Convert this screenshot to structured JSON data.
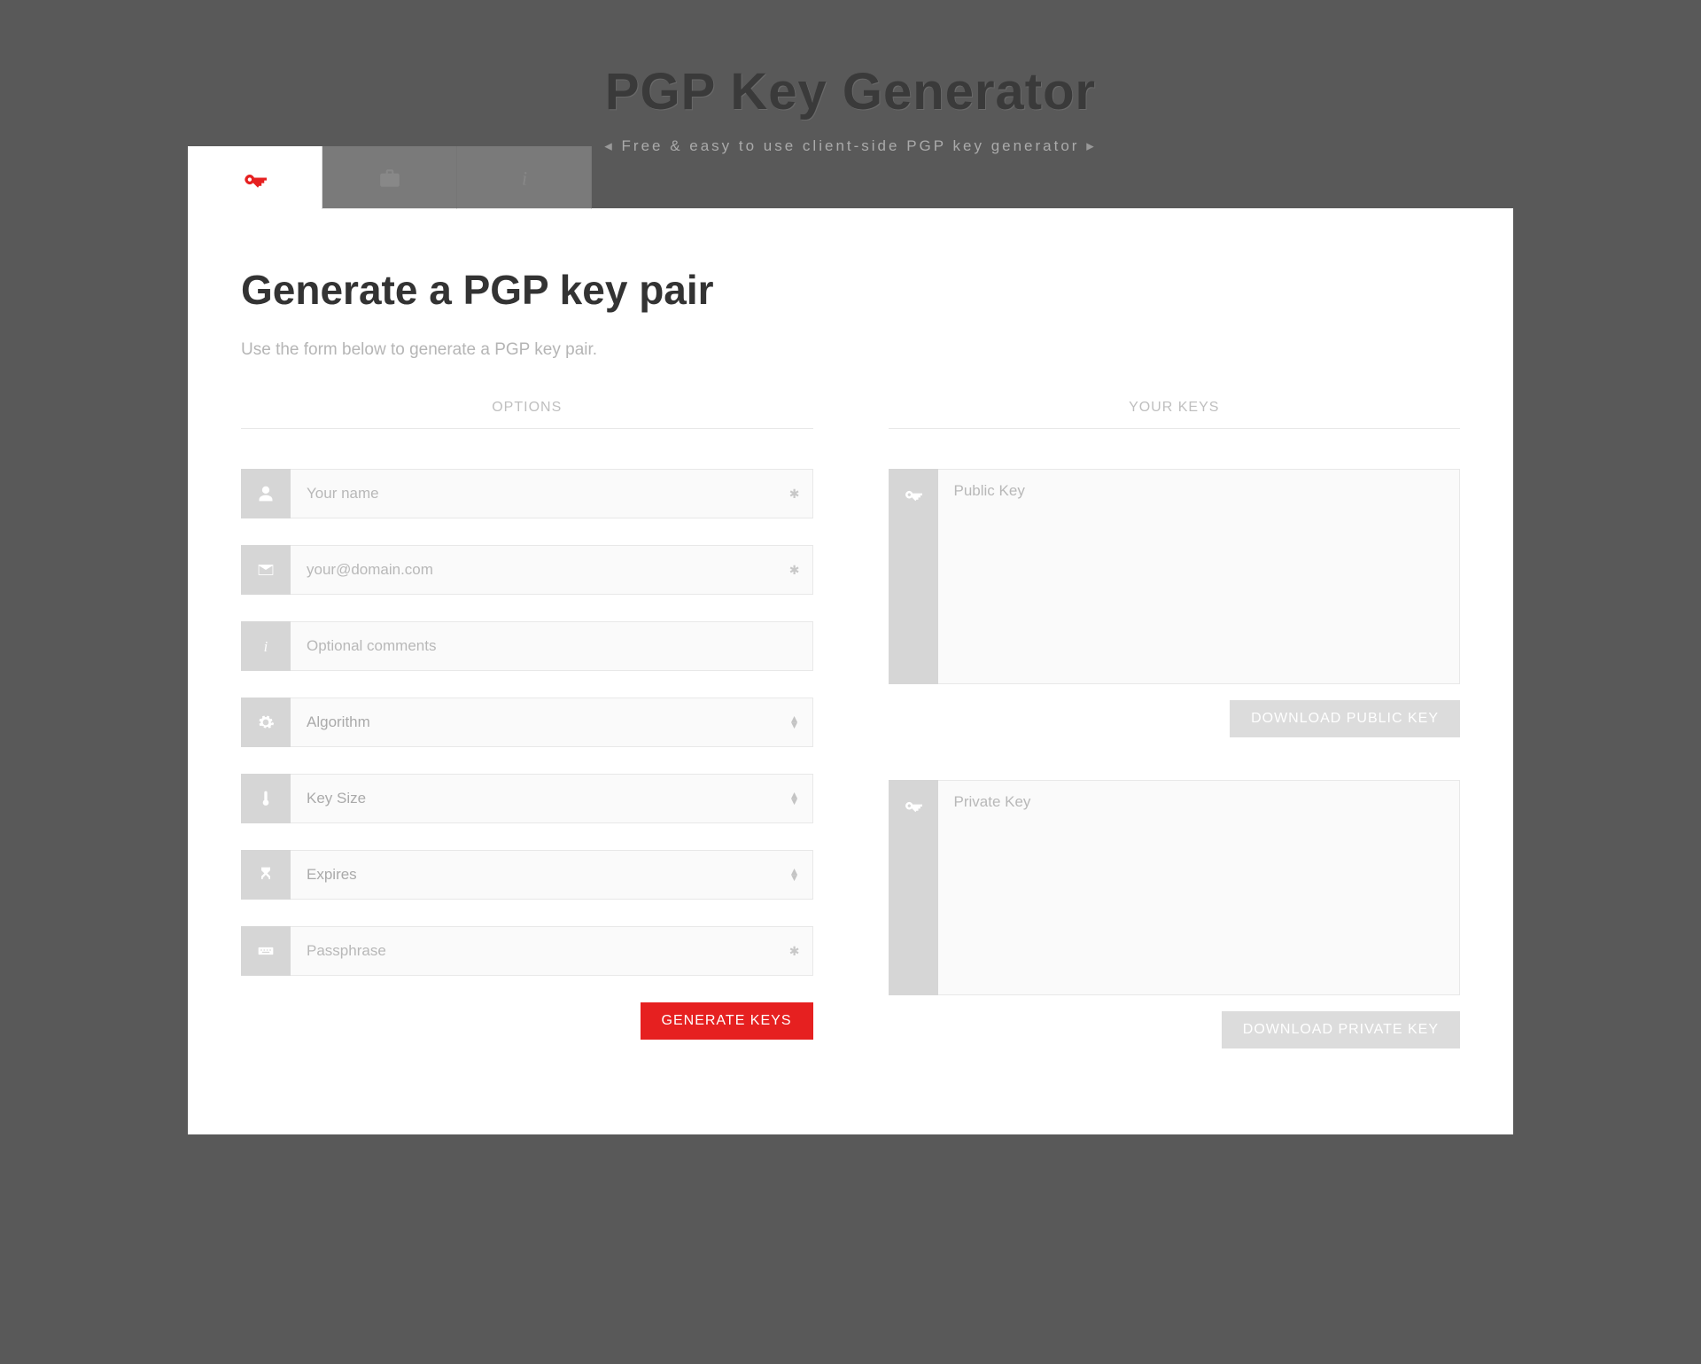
{
  "header": {
    "title": "PGP Key Generator",
    "subtitle": "Free & easy to use client-side PGP key generator"
  },
  "section": {
    "title": "Generate a PGP key pair",
    "description": "Use the form below to generate a PGP key pair."
  },
  "columns": {
    "options_label": "OPTIONS",
    "keys_label": "YOUR KEYS"
  },
  "fields": {
    "name_placeholder": "Your name",
    "email_placeholder": "your@domain.com",
    "comments_placeholder": "Optional comments",
    "algorithm_label": "Algorithm",
    "key_size_label": "Key Size",
    "expires_label": "Expires",
    "passphrase_placeholder": "Passphrase"
  },
  "outputs": {
    "public_key_placeholder": "Public Key",
    "private_key_placeholder": "Private Key"
  },
  "buttons": {
    "generate": "GENERATE KEYS",
    "download_public": "DOWNLOAD PUBLIC KEY",
    "download_private": "DOWNLOAD PRIVATE KEY"
  },
  "colors": {
    "accent": "#e62020",
    "background": "#595959"
  }
}
